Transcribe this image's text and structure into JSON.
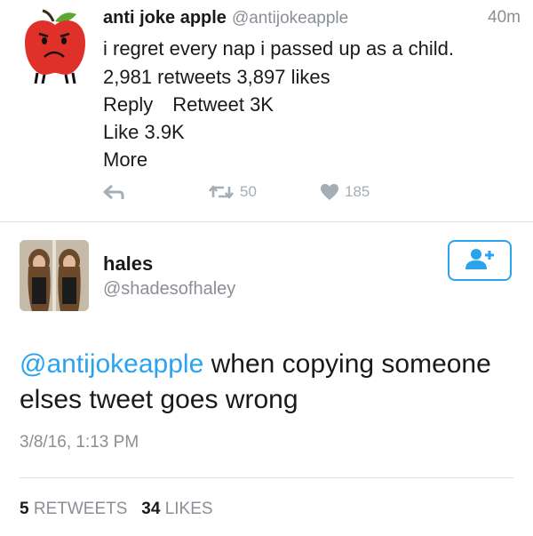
{
  "tweet1": {
    "name": "anti joke apple",
    "handle": "@antijokeapple",
    "time": "40m",
    "text": "i regret every nap i passed up as a child.",
    "stats": "2,981 retweets 3,897 likes",
    "reply_label": "Reply",
    "retweet_label": "Retweet 3K",
    "like_label": "Like 3.9K",
    "more_label": "More",
    "retweet_count": "50",
    "like_count": "185"
  },
  "tweet2": {
    "name": "hales",
    "handle": "@shadesofhaley",
    "mention": "@antijokeapple",
    "text": " when copying someone elses tweet goes wrong",
    "date": "3/8/16, 1:13 PM",
    "retweets_count": "5",
    "retweets_label": "RETWEETS",
    "likes_count": "34",
    "likes_label": "LIKES"
  },
  "colors": {
    "accent": "#2aa3ef",
    "muted": "#8a8f95",
    "apple_red": "#e0302a",
    "leaf_green": "#5aa832"
  },
  "icons": [
    "apple-avatar-icon",
    "reply-icon",
    "retweet-icon",
    "heart-icon",
    "follow-user-icon"
  ]
}
